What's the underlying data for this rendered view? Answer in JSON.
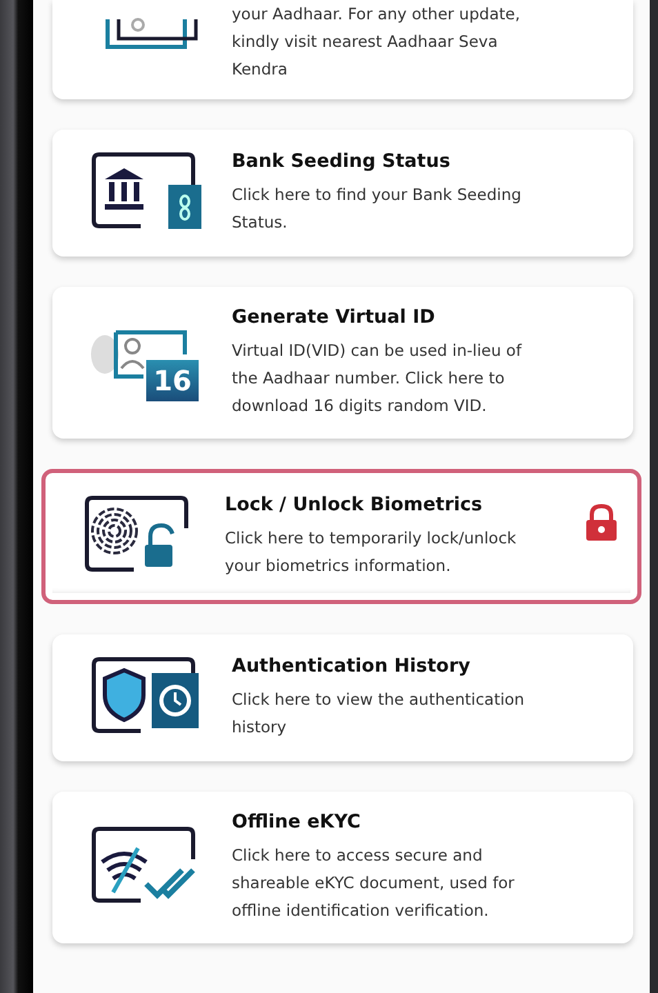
{
  "services": [
    {
      "kind": "partial",
      "description": "your Aadhaar. For any other update, kindly visit nearest Aadhaar Seva Kendra",
      "selected": false,
      "locked": false
    },
    {
      "kind": "bank",
      "title": "Bank Seeding Status",
      "description": "Click here to find your Bank Seeding Status.",
      "selected": false,
      "locked": false
    },
    {
      "kind": "vid",
      "title": "Generate Virtual ID",
      "description": "Virtual ID(VID) can be used in-lieu of the Aadhaar number. Click here to download 16 digits random VID.",
      "icon_text": "16",
      "selected": false,
      "locked": false
    },
    {
      "kind": "biometric",
      "title": "Lock / Unlock Biometrics",
      "description": "Click here to temporarily lock/unlock your biometrics information.",
      "selected": true,
      "locked": true
    },
    {
      "kind": "history",
      "title": "Authentication History",
      "description": "Click here to view the authentication history",
      "selected": false,
      "locked": false
    },
    {
      "kind": "ekyc",
      "title": "Offline eKYC",
      "description": "Click here to access secure and shareable eKYC document, used for offline identification verification.",
      "selected": false,
      "locked": false
    }
  ]
}
